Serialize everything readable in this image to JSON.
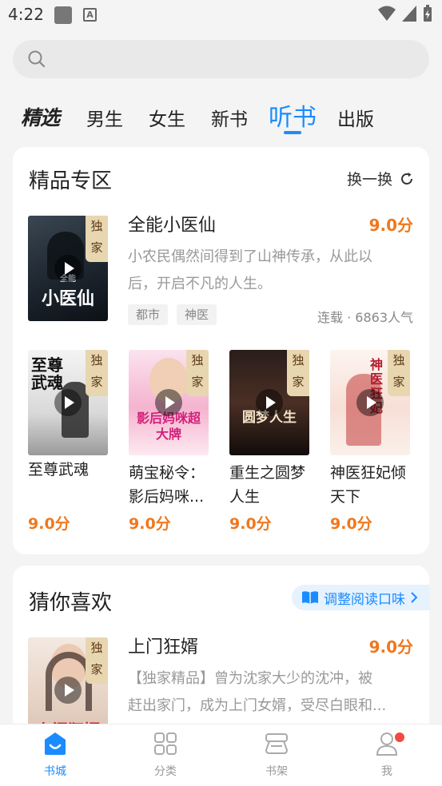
{
  "status": {
    "time": "4:22",
    "a_icon": "A"
  },
  "search": {
    "placeholder": ""
  },
  "tabs": [
    "精选",
    "男生",
    "女生",
    "新书",
    "听书",
    "出版"
  ],
  "active_tab": "听书",
  "featured": {
    "title": "精品专区",
    "swap_label": "换一换",
    "main_book": {
      "title": "全能小医仙",
      "score": "9.0分",
      "desc_line1": "小农民偶然间得到了山神传承，从此以",
      "desc_line2": "后，开启不凡的人生。",
      "tags": [
        "都市",
        "神医"
      ],
      "meta": "连载 · 6863人气",
      "badge": "独家",
      "cover_text_small": "全能",
      "cover_text_big": "小医仙"
    },
    "grid": [
      {
        "title_line1": "至尊武魂",
        "title_line2": "",
        "score": "9.0分",
        "badge": "独家",
        "cover_text": "至尊武魂"
      },
      {
        "title_line1": "萌宝秘令：",
        "title_line2": "影后妈咪...",
        "score": "9.0分",
        "badge": "独家",
        "cover_text": "影后妈咪超大牌"
      },
      {
        "title_line1": "重生之圆梦",
        "title_line2": "人生",
        "score": "9.0分",
        "badge": "独家",
        "cover_text": "圆梦人生"
      },
      {
        "title_line1": "神医狂妃倾",
        "title_line2": "天下",
        "score": "9.0分",
        "badge": "独家",
        "cover_text": "神医狂妃"
      }
    ]
  },
  "recommend": {
    "title": "猜你喜欢",
    "adjust_label": "调整阅读口味",
    "book": {
      "title": "上门狂婿",
      "score": "9.0分",
      "desc_line1": "【独家精品】曾为沈家大少的沈冲，被",
      "desc_line2": "赶出家门，成为上门女婿，受尽白眼和...",
      "badge": "独家",
      "cover_text": "上门狂婿"
    }
  },
  "nav": [
    "书城",
    "分类",
    "书架",
    "我"
  ],
  "colors": {
    "accent": "#1a8cff",
    "score": "#f0781e",
    "badge_bg": "#e8d6b0",
    "notify": "#f24b3e"
  }
}
